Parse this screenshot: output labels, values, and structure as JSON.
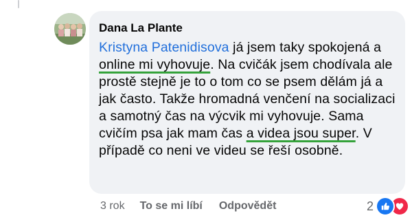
{
  "comment": {
    "author": "Dana La Plante",
    "mention": "Kristyna Patenidisova",
    "text": {
      "t1": " já jsem taky spokojená a ",
      "h1": "online mi vyhovuje",
      "t2": ". Na cvičák jsem chodívala ale prostě stejně je to o tom co se psem dělám já a jak často. Takže hromadná venčení na socializaci a samotný čas na výcvik mi vyhovuje. Sama cvičím psa jak mam čas ",
      "h2": "a videa jsou super",
      "t3": ". V případě co neni ve videu se řeší osobně."
    },
    "highlight_color": "#34a23a",
    "mention_color": "#216fdb"
  },
  "actions": {
    "age": "3 rok",
    "like_label": "To se mi líbí",
    "reply_label": "Odpovědět"
  },
  "reactions": {
    "count": "2",
    "icons": [
      "like-icon",
      "love-icon"
    ]
  }
}
